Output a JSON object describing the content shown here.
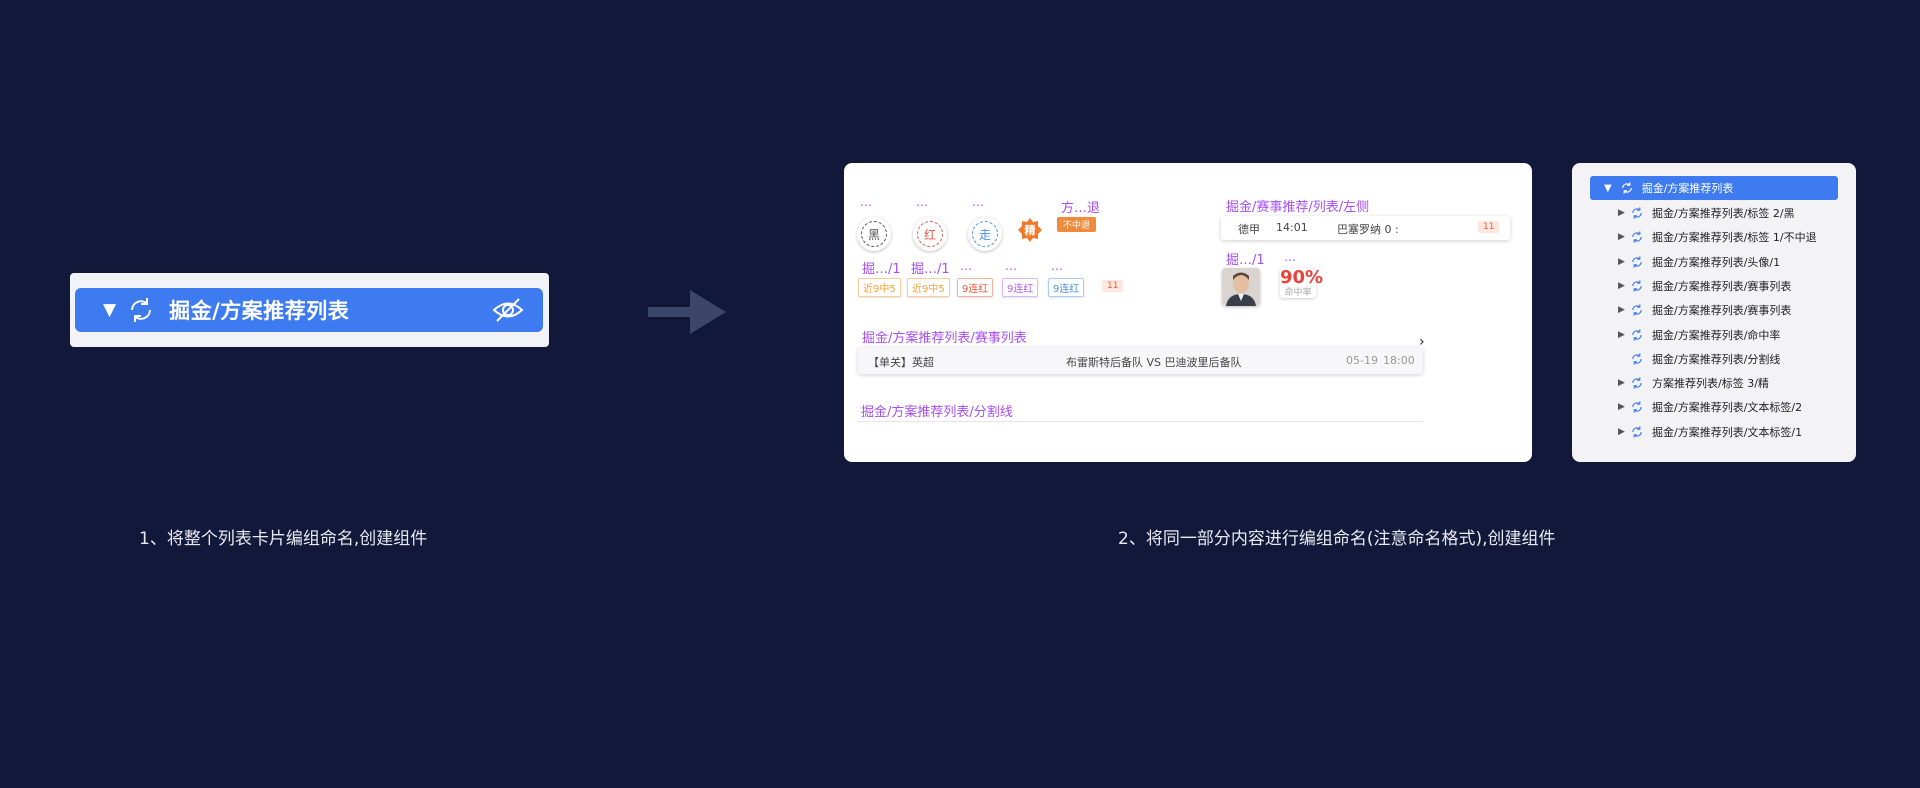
{
  "step1": {
    "layer_name": "掘金/方案推荐列表",
    "caption": "1、将整个列表卡片编组命名,创建组件"
  },
  "step2": {
    "caption": "2、将同一部分内容进行编组命名(注意命名格式),创建组件",
    "canvas": {
      "ellipsis": "…",
      "stamps": [
        {
          "char": "黑",
          "color": "#555555"
        },
        {
          "char": "红",
          "color": "#e35b4a"
        },
        {
          "char": "走",
          "color": "#4a8fe0"
        }
      ],
      "seal_char": "精",
      "nomiss_label": "方…退",
      "nomiss_text": "不中退",
      "short_label_1": "掘…/1",
      "short_label_2": "掘…/1",
      "tags": [
        {
          "text": "近9中5",
          "color": "#f0a33c"
        },
        {
          "text": "近9中5",
          "color": "#f0a33c"
        },
        {
          "text": "9连红",
          "color": "#e8583c"
        },
        {
          "text": "9连红",
          "color": "#b05ce8"
        },
        {
          "text": "9连红",
          "color": "#4a8fe0"
        }
      ],
      "tag_count": "11",
      "match_list_label": "掘金/赛事推荐/列表/左侧",
      "match_row": {
        "league": "德甲",
        "time": "14:01",
        "teams": "巴塞罗纳 0 :",
        "count": "11"
      },
      "avatar_label": "掘…/1",
      "hit_rate": {
        "value": "90%",
        "label": "命中率"
      },
      "event_list_label": "掘金/方案推荐列表/赛事列表",
      "chevron": "›",
      "event_row": {
        "league": "【单关】英超",
        "match": "布雷斯特后备队 VS 巴迪波里后备队",
        "date": "05-19",
        "time": "18:00"
      },
      "divider_label": "掘金/方案推荐列表/分割线"
    },
    "layers": {
      "selected": "掘金/方案推荐列表",
      "items": [
        {
          "name": "掘金/方案推荐列表/标签 2/黑",
          "expand": true
        },
        {
          "name": "掘金/方案推荐列表/标签 1/不中退",
          "expand": true
        },
        {
          "name": "掘金/方案推荐列表/头像/1",
          "expand": true
        },
        {
          "name": "掘金/方案推荐列表/赛事列表",
          "expand": true
        },
        {
          "name": "掘金/方案推荐列表/赛事列表",
          "expand": true
        },
        {
          "name": "掘金/方案推荐列表/命中率",
          "expand": true
        },
        {
          "name": "掘金/方案推荐列表/分割线",
          "expand": false
        },
        {
          "name": "方案推荐列表/标签 3/精",
          "expand": true
        },
        {
          "name": "掘金/方案推荐列表/文本标签/2",
          "expand": true
        },
        {
          "name": "掘金/方案推荐列表/文本标签/1",
          "expand": true
        }
      ]
    }
  },
  "colors": {
    "background": "#12183a",
    "accent": "#3f7bf0",
    "label_purple": "#a64ff0",
    "arrow": "#3c4668"
  }
}
